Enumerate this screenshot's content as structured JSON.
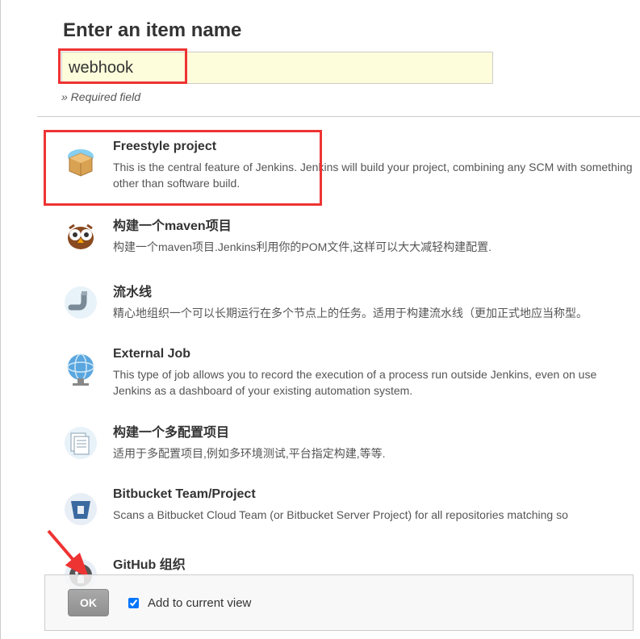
{
  "heading": "Enter an item name",
  "input": {
    "value": "webhook"
  },
  "required_hint": "» Required field",
  "items": [
    {
      "title": "Freestyle project",
      "desc": "This is the central feature of Jenkins. Jenkins will build your project, combining any SCM with something other than software build."
    },
    {
      "title": "构建一个maven项目",
      "desc": "构建一个maven项目.Jenkins利用你的POM文件,这样可以大大减轻构建配置."
    },
    {
      "title": "流水线",
      "desc": "精心地组织一个可以长期运行在多个节点上的任务。适用于构建流水线（更加正式地应当称型。"
    },
    {
      "title": "External Job",
      "desc": "This type of job allows you to record the execution of a process run outside Jenkins, even on use Jenkins as a dashboard of your existing automation system."
    },
    {
      "title": "构建一个多配置项目",
      "desc": "适用于多配置项目,例如多环境测试,平台指定构建,等等."
    },
    {
      "title": "Bitbucket Team/Project",
      "desc": "Scans a Bitbucket Cloud Team (or Bitbucket Server Project) for all repositories matching so"
    },
    {
      "title": "GitHub 组织",
      "desc": ""
    }
  ],
  "footer": {
    "ok_label": "OK",
    "checkbox_label": "Add to current view",
    "checked": true
  }
}
